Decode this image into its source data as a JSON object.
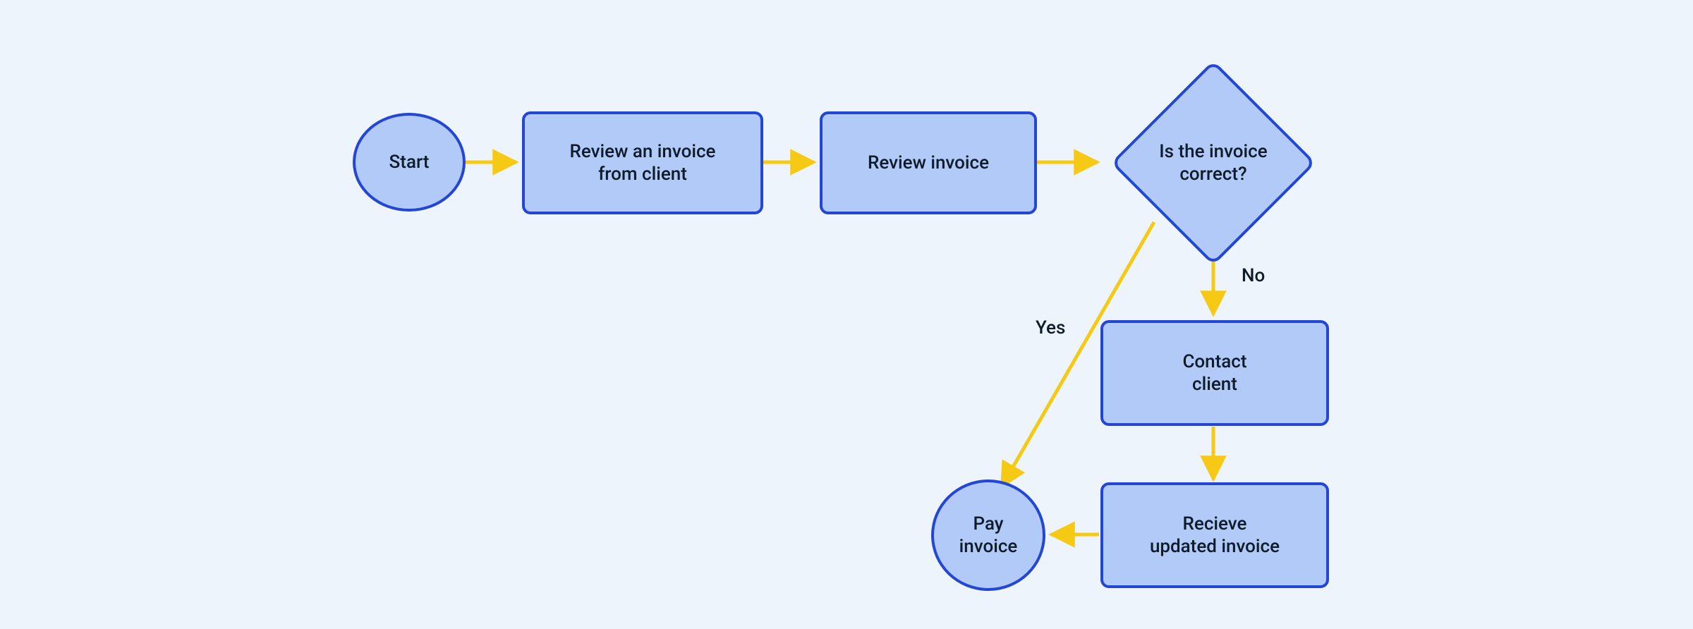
{
  "nodes": {
    "start": "Start",
    "review_from_client": "Review an invoice\nfrom client",
    "review_invoice": "Review invoice",
    "decision": "Is the invoice\ncorrect?",
    "contact_client": "Contact\nclient",
    "receive_updated": "Recieve\nupdated invoice",
    "pay_invoice": "Pay\ninvoice"
  },
  "edges": {
    "yes": "Yes",
    "no": "No"
  },
  "colors": {
    "bg": "#eef4fc",
    "node_fill": "#b1caf7",
    "node_stroke": "#2347d4",
    "arrow": "#f6c915",
    "text": "#0d1b2a"
  }
}
